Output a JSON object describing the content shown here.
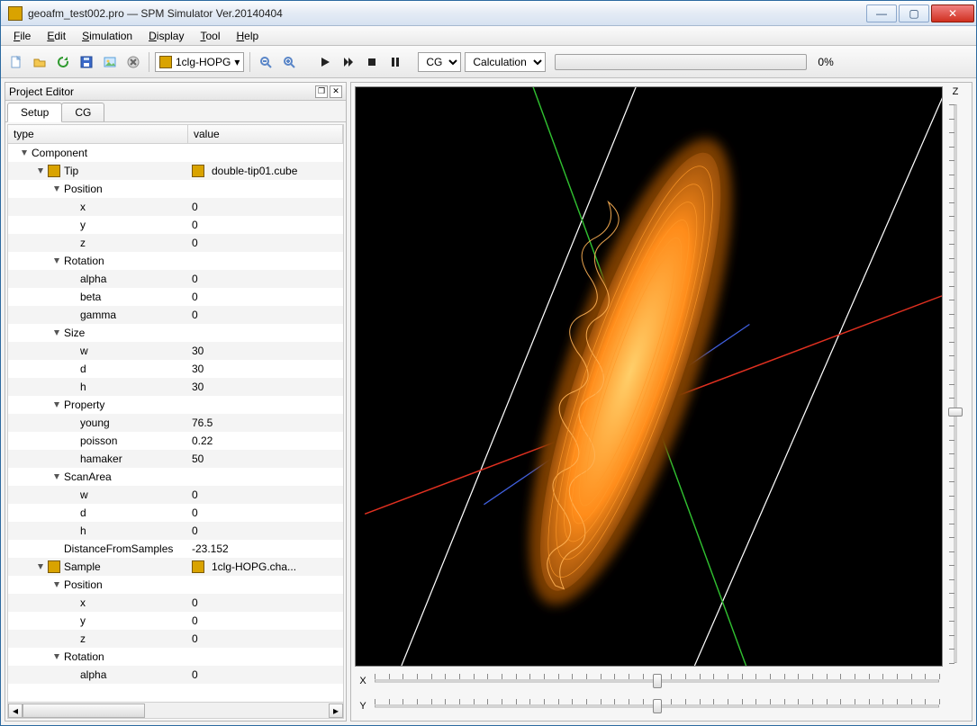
{
  "title": "geoafm_test002.pro — SPM Simulator Ver.20140404",
  "menus": {
    "file": "File",
    "edit": "Edit",
    "sim": "Simulation",
    "display": "Display",
    "tool": "Tool",
    "help": "Help"
  },
  "toolbar": {
    "sample_combo": "1clg-HOPG",
    "mode_select": "CG",
    "action_select": "Calculation",
    "progress_pct": "0%"
  },
  "project_editor": {
    "title": "Project Editor",
    "tabs": {
      "setup": "Setup",
      "cg": "CG"
    },
    "columns": {
      "type": "type",
      "value": "value"
    },
    "rows": [
      {
        "d": 0,
        "tw": "open",
        "label": "Component",
        "value": ""
      },
      {
        "d": 1,
        "tw": "open",
        "icon": true,
        "label": "Tip",
        "vicon": true,
        "value": "double-tip01.cube"
      },
      {
        "d": 2,
        "tw": "open",
        "label": "Position",
        "value": ""
      },
      {
        "d": 3,
        "label": "x",
        "value": "0"
      },
      {
        "d": 3,
        "label": "y",
        "value": "0"
      },
      {
        "d": 3,
        "label": "z",
        "value": "0"
      },
      {
        "d": 2,
        "tw": "open",
        "label": "Rotation",
        "value": ""
      },
      {
        "d": 3,
        "label": "alpha",
        "value": "0"
      },
      {
        "d": 3,
        "label": "beta",
        "value": "0"
      },
      {
        "d": 3,
        "label": "gamma",
        "value": "0"
      },
      {
        "d": 2,
        "tw": "open",
        "label": "Size",
        "value": ""
      },
      {
        "d": 3,
        "label": "w",
        "value": "30"
      },
      {
        "d": 3,
        "label": "d",
        "value": "30"
      },
      {
        "d": 3,
        "label": "h",
        "value": "30"
      },
      {
        "d": 2,
        "tw": "open",
        "label": "Property",
        "value": ""
      },
      {
        "d": 3,
        "label": "young",
        "value": "76.5"
      },
      {
        "d": 3,
        "label": "poisson",
        "value": "0.22"
      },
      {
        "d": 3,
        "label": "hamaker",
        "value": "50"
      },
      {
        "d": 2,
        "tw": "open",
        "label": "ScanArea",
        "value": ""
      },
      {
        "d": 3,
        "label": "w",
        "value": "0"
      },
      {
        "d": 3,
        "label": "d",
        "value": "0"
      },
      {
        "d": 3,
        "label": "h",
        "value": "0"
      },
      {
        "d": 2,
        "label": "DistanceFromSamples",
        "value": "-23.152"
      },
      {
        "d": 1,
        "tw": "open",
        "icon": true,
        "label": "Sample",
        "vicon": true,
        "value": "1clg-HOPG.cha..."
      },
      {
        "d": 2,
        "tw": "open",
        "label": "Position",
        "value": ""
      },
      {
        "d": 3,
        "label": "x",
        "value": "0"
      },
      {
        "d": 3,
        "label": "y",
        "value": "0"
      },
      {
        "d": 3,
        "label": "z",
        "value": "0"
      },
      {
        "d": 2,
        "tw": "open",
        "label": "Rotation",
        "value": ""
      },
      {
        "d": 3,
        "label": "alpha",
        "value": "0"
      }
    ]
  },
  "viewer": {
    "axis_z": "Z",
    "axis_x": "X",
    "axis_y": "Y",
    "z_pos": 0.55,
    "x_pos": 0.5,
    "y_pos": 0.5
  }
}
